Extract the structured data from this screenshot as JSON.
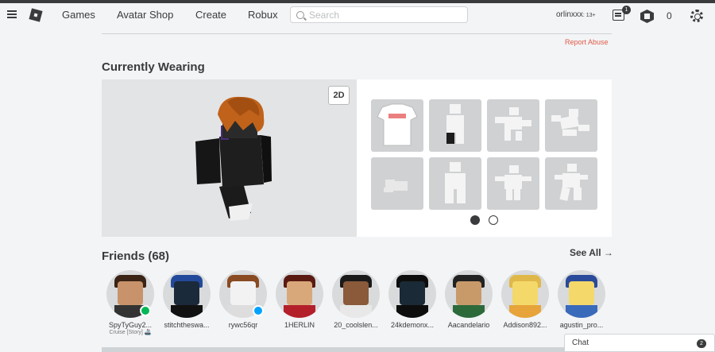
{
  "nav": {
    "games": "Games",
    "avatar_shop": "Avatar Shop",
    "create": "Create",
    "robux": "Robux",
    "search_placeholder": "Search",
    "username": "orlinxxx",
    "age_tag": ": 13+",
    "messages_count": "1",
    "robux_count": "0"
  },
  "page": {
    "report_abuse": "Report Abuse",
    "currently_wearing": "Currently Wearing",
    "toggle_2d": "2D",
    "friends_title": "Friends (68)",
    "see_all": "See All",
    "see_all_arrow": "→"
  },
  "friends": [
    {
      "name": "SpyTyGuy2...",
      "sub": "Cruise [Story] 🚢",
      "presence": "#02b757"
    },
    {
      "name": "stitchtheswa...",
      "sub": "",
      "presence": ""
    },
    {
      "name": "rywc56qr",
      "sub": "",
      "presence": "#00a2ff"
    },
    {
      "name": "1HERLIN",
      "sub": "",
      "presence": ""
    },
    {
      "name": "20_coolslen...",
      "sub": "",
      "presence": ""
    },
    {
      "name": "24kdemonx...",
      "sub": "",
      "presence": ""
    },
    {
      "name": "Aacandelario",
      "sub": "",
      "presence": ""
    },
    {
      "name": "Addison892...",
      "sub": "",
      "presence": ""
    },
    {
      "name": "agustin_pro...",
      "sub": "",
      "presence": ""
    }
  ],
  "chat": {
    "label": "Chat",
    "count": "2"
  },
  "colors": {
    "text": "#393b3d",
    "report": "#e25a4a",
    "online_game": "#02b757",
    "online": "#00a2ff"
  }
}
